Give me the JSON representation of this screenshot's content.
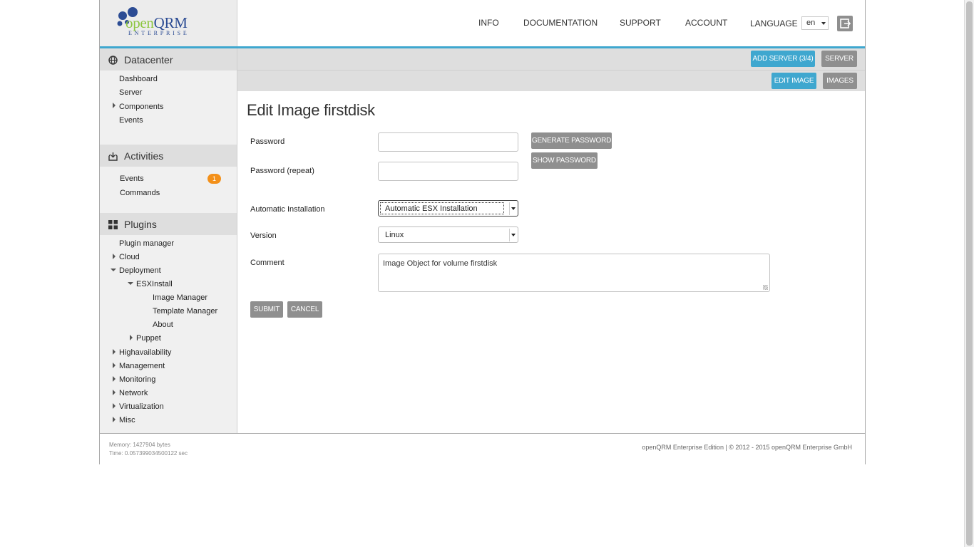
{
  "logo": {
    "open": "open",
    "qrm": "QRM",
    "sub": "ENTERPRISE"
  },
  "topnav": {
    "items": [
      "INFO",
      "DOCUMENTATION",
      "SUPPORT",
      "ACCOUNT"
    ],
    "language_label": "LANGUAGE",
    "language_value": "en"
  },
  "sidebar": {
    "datacenter": {
      "title": "Datacenter",
      "items": [
        "Dashboard",
        "Server",
        "Components",
        "Events"
      ]
    },
    "activities": {
      "title": "Activities",
      "items": [
        "Events",
        "Commands"
      ],
      "events_badge": "1"
    },
    "plugins": {
      "title": "Plugins",
      "items": [
        "Plugin manager",
        "Cloud",
        "Deployment",
        "ESXInstall",
        "Image Manager",
        "Template Manager",
        "About",
        "Puppet",
        "Highavailability",
        "Management",
        "Monitoring",
        "Network",
        "Virtualization",
        "Misc"
      ]
    }
  },
  "toolbar": {
    "add_server": "ADD SERVER (3/4)",
    "server": "SERVER",
    "edit_image": "EDIT IMAGE",
    "images": "IMAGES"
  },
  "form": {
    "title": "Edit Image firstdisk",
    "password_label": "Password",
    "password_value": "",
    "password_repeat_label": "Password (repeat)",
    "password_repeat_value": "",
    "generate_password": "GENERATE PASSWORD",
    "show_password": "SHOW PASSWORD",
    "auto_install_label": "Automatic Installation",
    "auto_install_value": "Automatic ESX Installation",
    "version_label": "Version",
    "version_value": "Linux",
    "comment_label": "Comment",
    "comment_value": "Image Object for volume firstdisk",
    "submit": "SUBMIT",
    "cancel": "CANCEL"
  },
  "footer": {
    "memory": "Memory: 1427904 bytes",
    "time": "Time: 0.057399034500122 sec",
    "copyright": "openQRM Enterprise Edition | © 2012 - 2015 openQRM Enterprise GmbH"
  },
  "colors": {
    "accent": "#3fa7cf",
    "gray_button": "#8f8f8f",
    "badge": "#f39019",
    "logo_green": "#8dc63f",
    "logo_blue": "#2c4c94"
  }
}
